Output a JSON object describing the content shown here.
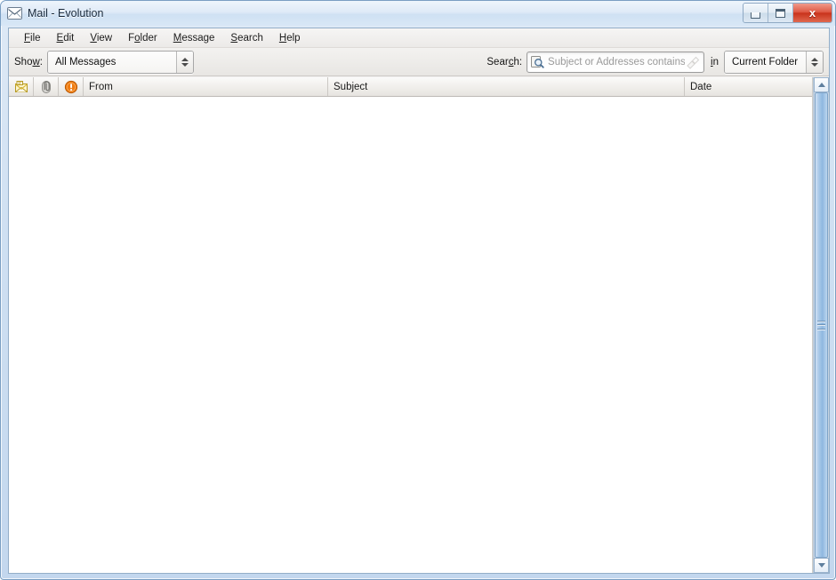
{
  "window": {
    "title": "Mail - Evolution",
    "icon": "envelope-icon",
    "controls": {
      "minimize_label": "Minimize",
      "maximize_label": "Maximize",
      "close_label": "Close",
      "close_glyph": "x",
      "close_color": "#c9331c"
    },
    "frame_color": "#cfe0f2"
  },
  "menubar": {
    "items": [
      {
        "label": "File",
        "mnemonic": "F"
      },
      {
        "label": "Edit",
        "mnemonic": "E"
      },
      {
        "label": "View",
        "mnemonic": "V"
      },
      {
        "label": "Folder",
        "mnemonic": "o"
      },
      {
        "label": "Message",
        "mnemonic": "M"
      },
      {
        "label": "Search",
        "mnemonic": "S"
      },
      {
        "label": "Help",
        "mnemonic": "H"
      }
    ]
  },
  "searchbar": {
    "show_label": "Show:",
    "show_mnemonic": "w",
    "show_value": "All Messages",
    "search_label": "Search:",
    "search_mnemonic": "c",
    "search_value": "",
    "search_placeholder": "Subject or Addresses contains",
    "find_icon": "find-icon",
    "clear_icon": "clear-search-icon",
    "in_label": "in",
    "in_mnemonic": "i",
    "scope_value": "Current Folder"
  },
  "message_list": {
    "columns": [
      {
        "key": "read",
        "label": "",
        "icon": "envelope-read-icon"
      },
      {
        "key": "attachment",
        "label": "",
        "icon": "paperclip-icon"
      },
      {
        "key": "importance",
        "label": "",
        "icon": "important-icon"
      },
      {
        "key": "from",
        "label": "From",
        "icon": ""
      },
      {
        "key": "subject",
        "label": "Subject",
        "icon": ""
      },
      {
        "key": "date",
        "label": "Date",
        "icon": ""
      }
    ],
    "rows": []
  },
  "scrollbar": {
    "up_label": "Scroll up",
    "down_label": "Scroll down",
    "thumb_label": "Scroll thumb"
  }
}
